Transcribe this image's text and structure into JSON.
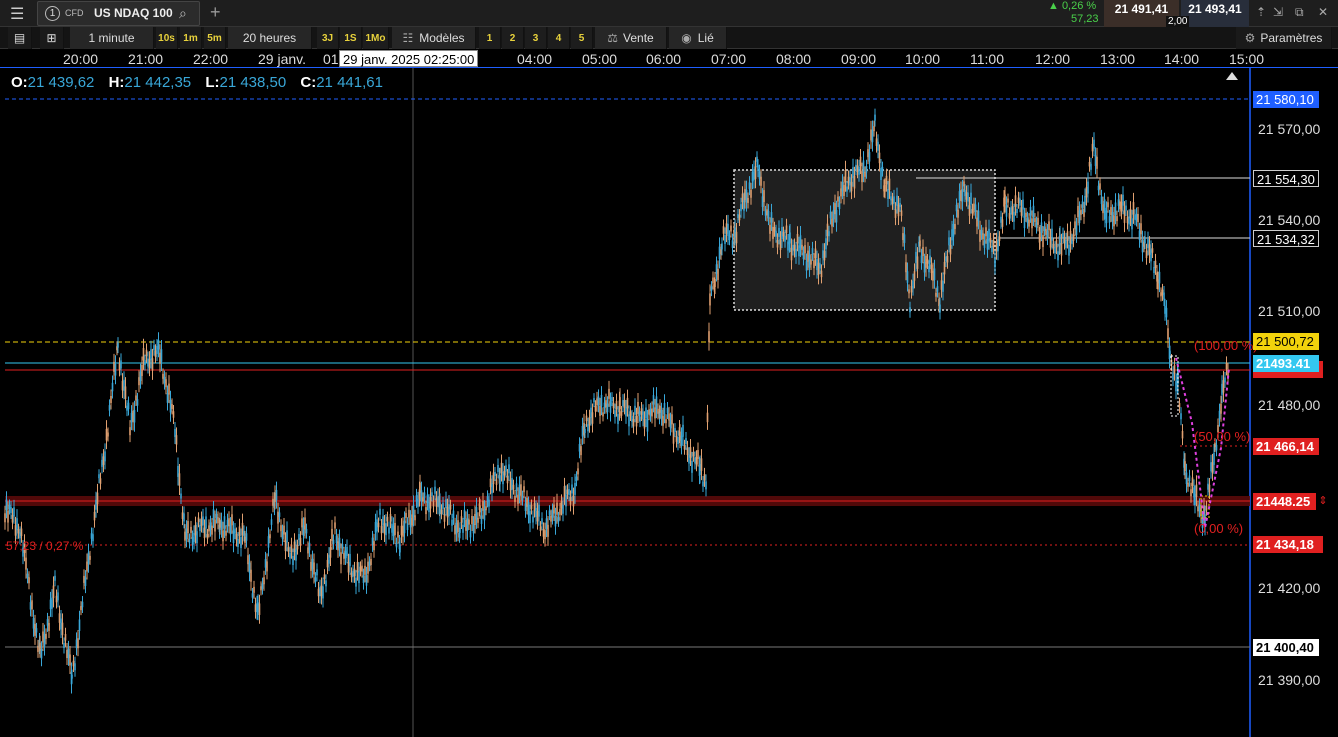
{
  "topbar": {
    "menu_icon": "hamburger-icon",
    "instrument_number": "1",
    "instrument_type": "CFD",
    "instrument_name": "US NDAQ 100",
    "change_pct": "▲ 0,26 %",
    "change_pts": "57,23",
    "sell_price": "21 491,41",
    "spread": "2,00",
    "buy_price": "21 493,41"
  },
  "toolbar": {
    "interval": "1 minute",
    "quick_intervals": [
      "10s",
      "1m",
      "5m"
    ],
    "range": "20 heures",
    "quick_ranges": [
      "3J",
      "1S",
      "1Mo"
    ],
    "templates": "Modèles",
    "template_slots": [
      "1",
      "2",
      "3",
      "4",
      "5"
    ],
    "sell": "Vente",
    "linked": "Lié",
    "settings": "Paramètres"
  },
  "time_axis": {
    "labels": [
      "20:00",
      "21:00",
      "22:00",
      "29 janv.",
      "01",
      "04:00",
      "05:00",
      "06:00",
      "07:00",
      "08:00",
      "09:00",
      "10:00",
      "11:00",
      "12:00",
      "13:00",
      "14:00",
      "15:00"
    ],
    "cursor_label": "29 janv. 2025 02:25:00"
  },
  "ohlc": {
    "o_label": "O:",
    "o": "21 439,62",
    "h_label": "H:",
    "h": "21 442,35",
    "l_label": "L:",
    "l": "21 438,50",
    "c_label": "C:",
    "c": "21 441,61"
  },
  "price_axis": {
    "ticks": [
      "21 570,00",
      "21 540,00",
      "21 510,00",
      "21 480,00",
      "21 420,00",
      "21 390,00"
    ],
    "labels": {
      "alert_top": "21 580,10",
      "box_high": "21 554,30",
      "box_low": "21 534,32",
      "yellow_line": "21 500,72",
      "current": "21493.41",
      "red_line": "21 466,14",
      "band": "21448.25",
      "low_line": "21 434,18",
      "cursor": "21 400,40"
    }
  },
  "annotations": {
    "fib_100": "(100,00 %)",
    "fib_50": "(50,00 %)",
    "fib_0": "(0,00 %)",
    "measure": "57,23 / 0,27 %"
  },
  "colors": {
    "up_candle": "#39a7d8",
    "down_candle": "#e0a070",
    "accent_blue": "#1f5fff",
    "red": "#e02020",
    "yellow": "#f2d20c",
    "cyan": "#33c8f0"
  }
}
